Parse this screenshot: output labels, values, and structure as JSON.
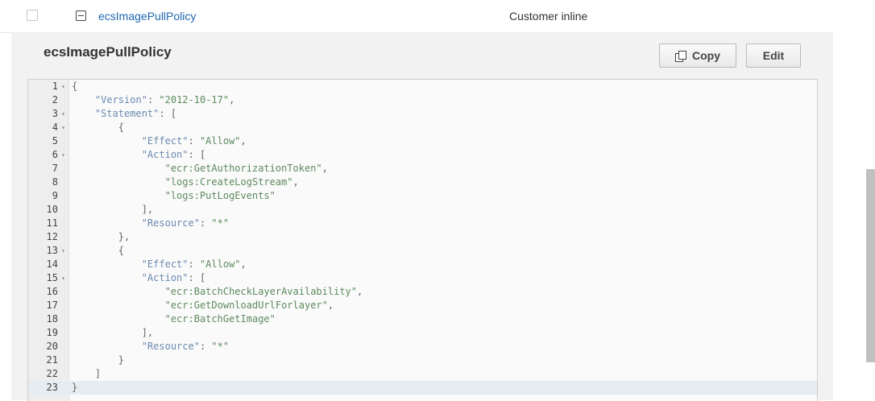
{
  "policy_row": {
    "name": "ecsImagePullPolicy",
    "type": "Customer inline"
  },
  "panel": {
    "title": "ecsImagePullPolicy",
    "copy_label": "Copy",
    "edit_label": "Edit"
  },
  "editor": {
    "lines": [
      {
        "n": "1",
        "fold": "▾",
        "text": "{"
      },
      {
        "n": "2",
        "fold": "",
        "text": "    \"Version\": \"2012-10-17\","
      },
      {
        "n": "3",
        "fold": "▾",
        "text": "    \"Statement\": ["
      },
      {
        "n": "4",
        "fold": "▾",
        "text": "        {"
      },
      {
        "n": "5",
        "fold": "",
        "text": "            \"Effect\": \"Allow\","
      },
      {
        "n": "6",
        "fold": "▾",
        "text": "            \"Action\": ["
      },
      {
        "n": "7",
        "fold": "",
        "text": "                \"ecr:GetAuthorizationToken\","
      },
      {
        "n": "8",
        "fold": "",
        "text": "                \"logs:CreateLogStream\","
      },
      {
        "n": "9",
        "fold": "",
        "text": "                \"logs:PutLogEvents\""
      },
      {
        "n": "10",
        "fold": "",
        "text": "            ],"
      },
      {
        "n": "11",
        "fold": "",
        "text": "            \"Resource\": \"*\""
      },
      {
        "n": "12",
        "fold": "",
        "text": "        },"
      },
      {
        "n": "13",
        "fold": "▾",
        "text": "        {"
      },
      {
        "n": "14",
        "fold": "",
        "text": "            \"Effect\": \"Allow\","
      },
      {
        "n": "15",
        "fold": "▾",
        "text": "            \"Action\": ["
      },
      {
        "n": "16",
        "fold": "",
        "text": "                \"ecr:BatchCheckLayerAvailability\","
      },
      {
        "n": "17",
        "fold": "",
        "text": "                \"ecr:GetDownloadUrlForlayer\","
      },
      {
        "n": "18",
        "fold": "",
        "text": "                \"ecr:BatchGetImage\""
      },
      {
        "n": "19",
        "fold": "",
        "text": "            ],"
      },
      {
        "n": "20",
        "fold": "",
        "text": "            \"Resource\": \"*\""
      },
      {
        "n": "21",
        "fold": "",
        "text": "        }"
      },
      {
        "n": "22",
        "fold": "",
        "text": "    ]"
      },
      {
        "n": "23",
        "fold": "",
        "text": "}"
      }
    ],
    "active_line": 23
  },
  "icons": {
    "row_checkbox": "checkbox-icon",
    "collapse": "collapse-minus-icon",
    "copy": "copy-icon",
    "fold": "fold-arrow-icon"
  },
  "colors": {
    "link": "#1f67b1",
    "string": "#5d8a5d",
    "key": "#6b8ab0",
    "punctuation": "#666666"
  }
}
